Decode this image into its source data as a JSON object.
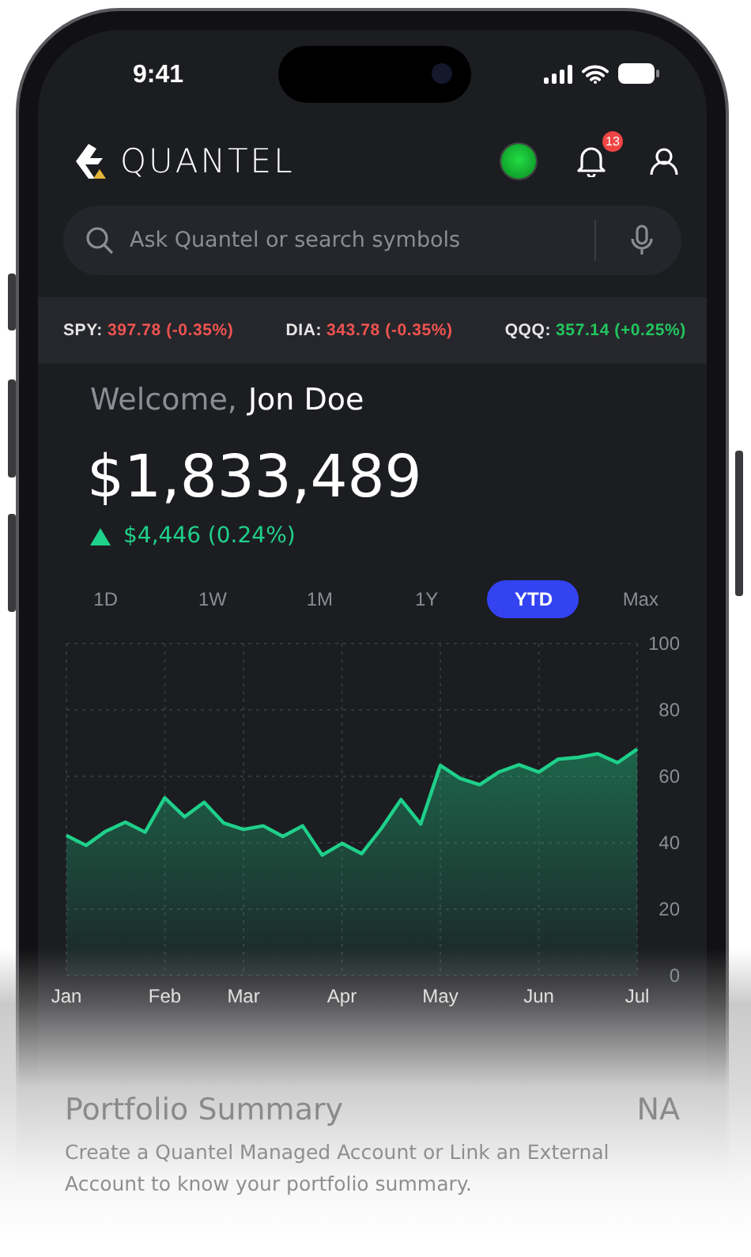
{
  "status_bar": {
    "time": "9:41"
  },
  "header": {
    "brand": "QUANTEL",
    "notification_count": "13"
  },
  "search": {
    "placeholder": "Ask Quantel or search symbols"
  },
  "tickers": [
    {
      "symbol": "SPY:",
      "quote": "397.78 (-0.35%)",
      "color": "#ef5350"
    },
    {
      "symbol": "DIA:",
      "quote": "343.78 (-0.35%)",
      "color": "#ef5350"
    },
    {
      "symbol": "QQQ:",
      "quote": "357.14 (+0.25%)",
      "color": "#22c55e"
    }
  ],
  "portfolio": {
    "greeting": "Welcome,",
    "name": "Jon Doe",
    "balance": "$1,833,489",
    "change": "$4,446 (0.24%)"
  },
  "ranges": [
    {
      "label": "1D",
      "selected": false
    },
    {
      "label": "1W",
      "selected": false
    },
    {
      "label": "1M",
      "selected": false
    },
    {
      "label": "1Y",
      "selected": false
    },
    {
      "label": "YTD",
      "selected": true
    },
    {
      "label": "Max",
      "selected": false
    }
  ],
  "chart_data": {
    "type": "area",
    "categories": [
      "Jan",
      null,
      null,
      null,
      null,
      "Feb",
      null,
      null,
      null,
      "Mar",
      null,
      null,
      null,
      null,
      "Apr",
      null,
      null,
      null,
      null,
      "May",
      null,
      null,
      null,
      null,
      "Jun",
      null,
      null,
      null,
      null,
      "Jul"
    ],
    "series": [
      {
        "color": "#1fd08a",
        "values": [
          42.2,
          39.2,
          43.5,
          46.2,
          43.2,
          53.5,
          47.8,
          52.2,
          45.9,
          44,
          45.1,
          41.9,
          45.1,
          36.3,
          39.8,
          36.7,
          44.3,
          53,
          45.6,
          63.3,
          59.4,
          57.5,
          61.4,
          63.5,
          61.3,
          65.2,
          65.7,
          66.8,
          64.1,
          68.2
        ]
      }
    ],
    "ylim": [
      0,
      100
    ],
    "grid": true,
    "yticks": [
      0,
      20,
      40,
      60,
      80,
      100
    ]
  },
  "summary": {
    "title": "Portfolio Summary",
    "value": "NA",
    "description": "Create a Quantel Managed Account or Link an External Account to know your portfolio summary."
  }
}
